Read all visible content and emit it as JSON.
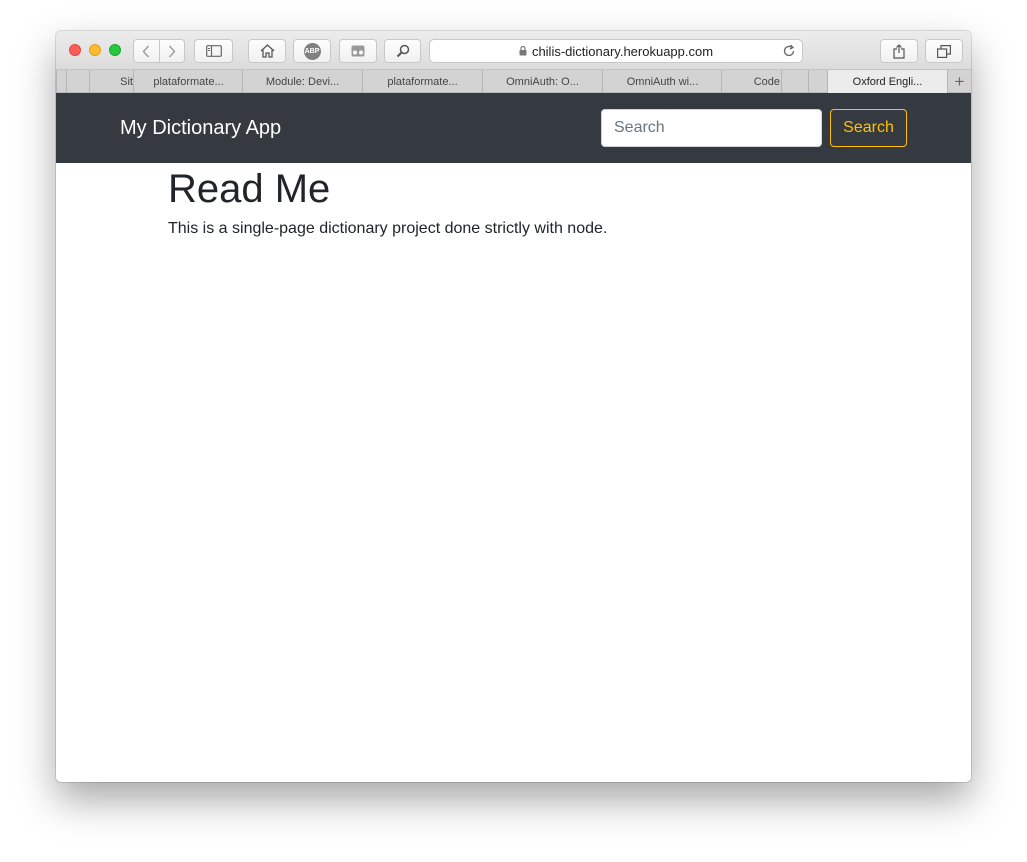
{
  "browser": {
    "url": "chilis-dictionary.herokuapp.com",
    "icons": {
      "back": "chevron-left-icon",
      "forward": "chevron-right-icon",
      "sidebar": "sidebar-icon",
      "home": "home-icon",
      "adblock": "abp-icon",
      "extension": "extension-icon",
      "search": "magnifier-icon",
      "lock": "lock-icon",
      "reload": "reload-icon",
      "share": "share-icon",
      "tabs": "tabs-overview-icon"
    },
    "adblock_label": "ABP",
    "tabs": [
      {
        "label": "Sit"
      },
      {
        "label": "plataformate..."
      },
      {
        "label": "Module: Devi..."
      },
      {
        "label": "plataformate..."
      },
      {
        "label": "OmniAuth: O..."
      },
      {
        "label": "OmniAuth wi..."
      },
      {
        "label": "Code"
      },
      {
        "label": "Oxford Engli..."
      }
    ],
    "new_tab_label": "+"
  },
  "navbar": {
    "brand": "My Dictionary App",
    "search_placeholder": "Search",
    "search_button": "Search",
    "background_color": "#343a40",
    "accent_color": "#ffc107"
  },
  "main": {
    "title": "Read Me",
    "description": "This is a single-page dictionary project done strictly with node."
  }
}
